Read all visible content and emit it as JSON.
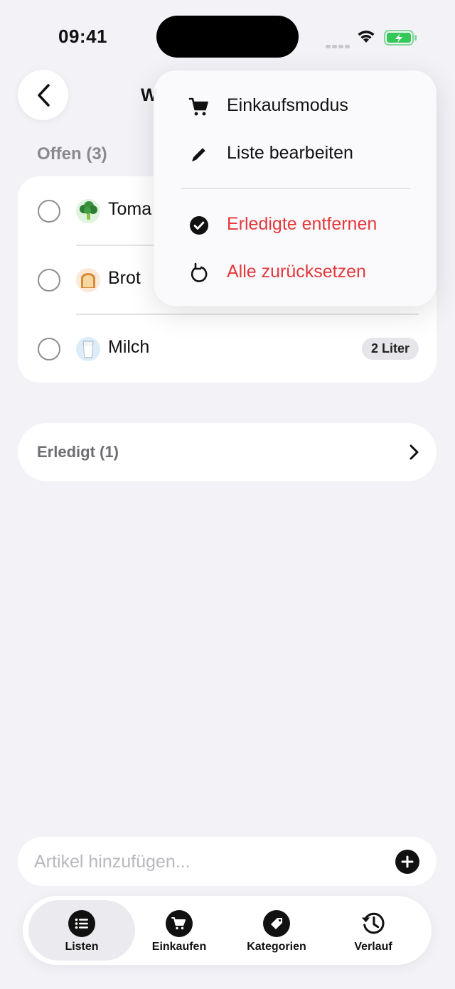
{
  "status_bar": {
    "time": "09:41",
    "icons": [
      "cellular-signal-icon",
      "wifi-icon",
      "battery-charging-icon"
    ],
    "battery_color": "#34c759"
  },
  "header": {
    "back_icon": "chevron-left-icon",
    "title": "W"
  },
  "open_section": {
    "title": "Offen (3)",
    "items": [
      {
        "name": "Toma",
        "emoji": "🥦",
        "quantity": ""
      },
      {
        "name": "Brot",
        "emoji": "🍞",
        "quantity": ""
      },
      {
        "name": "Milch",
        "emoji": "🥛",
        "quantity": "2 Liter"
      }
    ]
  },
  "done_section": {
    "label": "Erledigt (1)",
    "chevron_icon": "chevron-right-icon"
  },
  "menu": {
    "items": [
      {
        "label": "Einkaufsmodus",
        "icon": "cart-icon",
        "danger": false
      },
      {
        "label": "Liste bearbeiten",
        "icon": "pencil-icon",
        "danger": false
      },
      {
        "label": "Erledigte entfernen",
        "icon": "checkmark-circle-icon",
        "danger": true
      },
      {
        "label": "Alle zurücksetzen",
        "icon": "reset-arrow-icon",
        "danger": true
      }
    ],
    "danger_color": "#e5383b"
  },
  "add_bar": {
    "placeholder": "Artikel hinzufügen...",
    "add_icon": "plus-circle-icon"
  },
  "tab_bar": {
    "tabs": [
      {
        "label": "Listen",
        "icon": "list-icon",
        "active": true
      },
      {
        "label": "Einkaufen",
        "icon": "cart-icon",
        "active": false
      },
      {
        "label": "Kategorien",
        "icon": "tag-icon",
        "active": false
      },
      {
        "label": "Verlauf",
        "icon": "history-icon",
        "active": false
      }
    ]
  }
}
